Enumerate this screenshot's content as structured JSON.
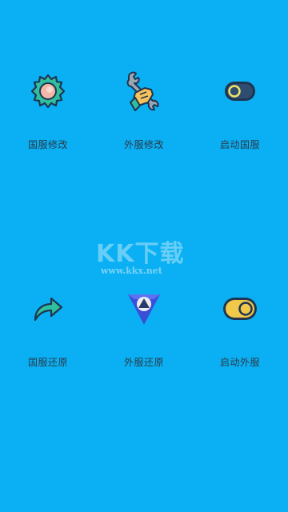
{
  "background_color": "#0ab0f3",
  "actions": [
    {
      "label": "国服修改",
      "icon": "gear-icon"
    },
    {
      "label": "外服修改",
      "icon": "wrench-hand-icon"
    },
    {
      "label": "启动国服",
      "icon": "toggle-icon"
    },
    {
      "label": "国服还原",
      "icon": "share-arrow-icon"
    },
    {
      "label": "外服还原",
      "icon": "triangle-logo-icon"
    },
    {
      "label": "启动外服",
      "icon": "toggle-icon"
    }
  ],
  "watermark": {
    "logo": "KK下载",
    "url": "www.kkx.net"
  }
}
